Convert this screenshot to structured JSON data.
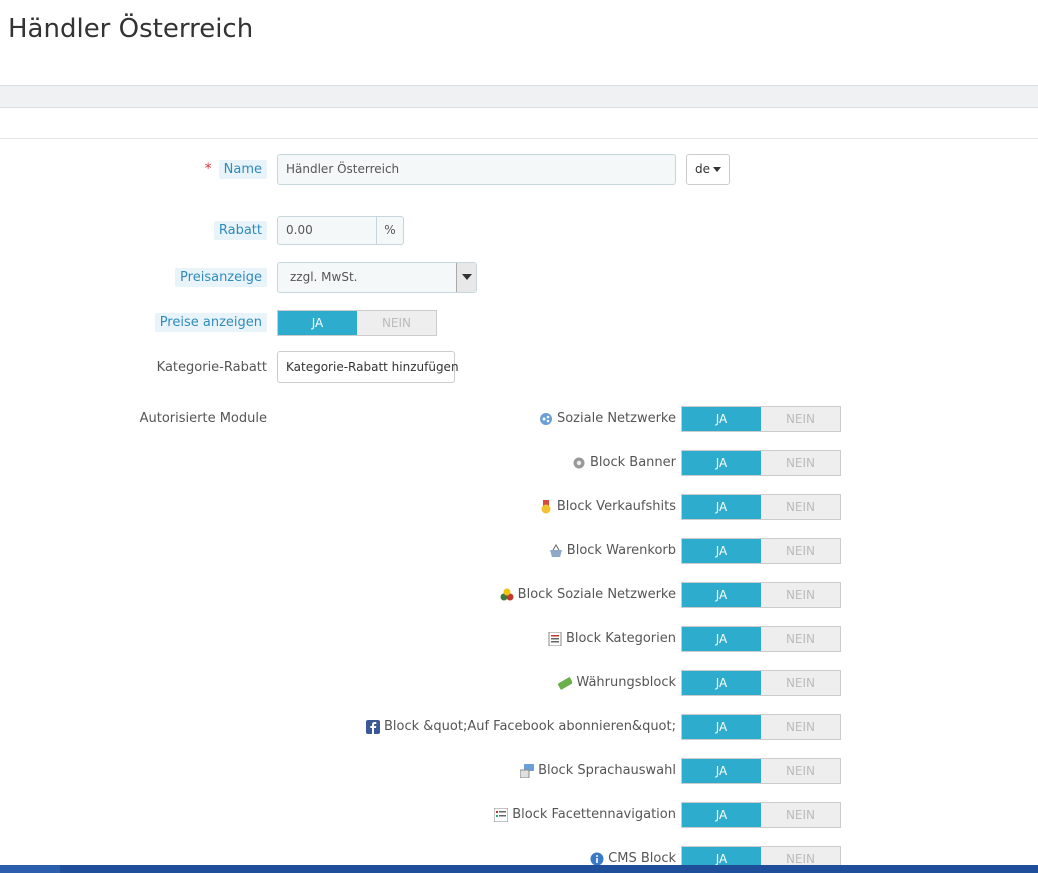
{
  "page": {
    "title": "Händler Österreich"
  },
  "form": {
    "name_label": "Name",
    "name_required": "*",
    "name_value": "Händler Österreich",
    "lang_value": "de",
    "discount_label": "Rabatt",
    "discount_value": "0.00",
    "discount_unit": "%",
    "price_display_label": "Preisanzeige",
    "price_display_value": "zzgl. MwSt.",
    "show_prices_label": "Preise anzeigen",
    "show_prices_yes": "JA",
    "show_prices_no": "NEIN",
    "category_discount_label": "Kategorie-Rabatt",
    "category_discount_button": "Kategorie-Rabatt hinzufügen",
    "modules_label": "Autorisierte Module"
  },
  "modules": [
    {
      "label": "Soziale Netzwerke",
      "icon": "share-icon",
      "yes": "JA",
      "no": "NEIN",
      "enabled": true
    },
    {
      "label": "Block Banner",
      "icon": "gear-icon",
      "yes": "JA",
      "no": "NEIN",
      "enabled": true
    },
    {
      "label": "Block Verkaufshits",
      "icon": "award-icon",
      "yes": "JA",
      "no": "NEIN",
      "enabled": true
    },
    {
      "label": "Block Warenkorb",
      "icon": "basket-icon",
      "yes": "JA",
      "no": "NEIN",
      "enabled": true
    },
    {
      "label": "Block Soziale Netzwerke",
      "icon": "social-icons-icon",
      "yes": "JA",
      "no": "NEIN",
      "enabled": true
    },
    {
      "label": "Block Kategorien",
      "icon": "list-icon",
      "yes": "JA",
      "no": "NEIN",
      "enabled": true
    },
    {
      "label": "Währungsblock",
      "icon": "money-icon",
      "yes": "JA",
      "no": "NEIN",
      "enabled": true
    },
    {
      "label": "Block &quot;Auf Facebook abonnieren&quot;",
      "icon": "facebook-icon",
      "yes": "JA",
      "no": "NEIN",
      "enabled": true
    },
    {
      "label": "Block Sprachauswahl",
      "icon": "language-icon",
      "yes": "JA",
      "no": "NEIN",
      "enabled": true
    },
    {
      "label": "Block Facettennavigation",
      "icon": "filter-list-icon",
      "yes": "JA",
      "no": "NEIN",
      "enabled": true
    },
    {
      "label": "CMS Block",
      "icon": "info-icon",
      "yes": "JA",
      "no": "NEIN",
      "enabled": true
    }
  ],
  "colors": {
    "accent": "#2eacce",
    "label_tip_bg": "#e9f4fa",
    "label_tip_text": "#2f8bbd",
    "required": "#e0313f"
  }
}
